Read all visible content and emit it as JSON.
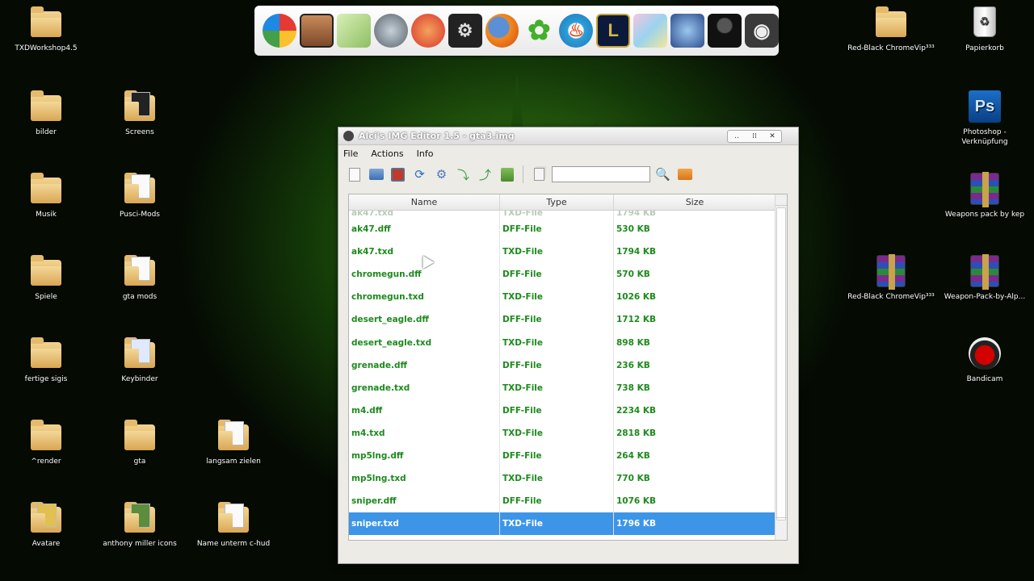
{
  "desktop_icons": {
    "txdworkshop": "TXDWorkshop4.5",
    "bilder": "bilder",
    "screens": "Screens",
    "musik": "Musik",
    "pusci_mods": "Pusci-Mods",
    "spiele": "Spiele",
    "gta_mods": "gta mods",
    "fertige_sigis": "fertige sigis",
    "keybinder": "Keybinder",
    "render": "^render",
    "gta": "gta",
    "langsam_zielen": "langsam zielen",
    "avatare": "Avatare",
    "anthony_miller_icons": "anthony miller icons",
    "name_unterm_chud": "Name unterm c-hud",
    "red_black_chrome_1": "Red-Black ChromeVip³³³",
    "papierkorb": "Papierkorb",
    "photoshop": "Photoshop - Verknüpfung",
    "weapons_pack": "Weapons pack by kep",
    "red_black_chrome_2": "Red-Black ChromeVip³³³",
    "weapon_pack_alp": "Weapon-Pack-by-Alp...",
    "bandicam": "Bandicam"
  },
  "dock": {
    "items": [
      "picasa",
      "gta-char",
      "notepad",
      "teamspeak",
      "ccleaner",
      "nfs",
      "firefox",
      "icq",
      "nero",
      "league-of-legends",
      "package",
      "game-art",
      "character",
      "steam"
    ]
  },
  "window": {
    "title": "Alci's IMG Editor 1.5 - gta3.img",
    "controls": {
      "minimize": "‥",
      "maximize": "⁞⁞",
      "close": "✕"
    },
    "menu": {
      "file": "File",
      "actions": "Actions",
      "info": "Info"
    },
    "search": {
      "value": ""
    },
    "table": {
      "headers": {
        "name": "Name",
        "type": "Type",
        "size": "Size"
      },
      "partial_row": {
        "name": "ak47.txd",
        "type": "TXD-File",
        "size": "1794 KB"
      },
      "rows": [
        {
          "name": "ak47.dff",
          "type": "DFF-File",
          "size": "530 KB"
        },
        {
          "name": "ak47.txd",
          "type": "TXD-File",
          "size": "1794 KB"
        },
        {
          "name": "chromegun.dff",
          "type": "DFF-File",
          "size": "570 KB"
        },
        {
          "name": "chromegun.txd",
          "type": "TXD-File",
          "size": "1026 KB"
        },
        {
          "name": "desert_eagle.dff",
          "type": "DFF-File",
          "size": "1712 KB"
        },
        {
          "name": "desert_eagle.txd",
          "type": "TXD-File",
          "size": "898 KB"
        },
        {
          "name": "grenade.dff",
          "type": "DFF-File",
          "size": "236 KB"
        },
        {
          "name": "grenade.txd",
          "type": "TXD-File",
          "size": "738 KB"
        },
        {
          "name": "m4.dff",
          "type": "DFF-File",
          "size": "2234 KB"
        },
        {
          "name": "m4.txd",
          "type": "TXD-File",
          "size": "2818 KB"
        },
        {
          "name": "mp5lng.dff",
          "type": "DFF-File",
          "size": "264 KB"
        },
        {
          "name": "mp5lng.txd",
          "type": "TXD-File",
          "size": "770 KB"
        },
        {
          "name": "sniper.dff",
          "type": "DFF-File",
          "size": "1076 KB"
        },
        {
          "name": "sniper.txd",
          "type": "TXD-File",
          "size": "1796 KB"
        }
      ],
      "selected_index": 13
    }
  },
  "colors": {
    "row_text": "#1d8a1d",
    "selection": "#3d95e8"
  }
}
